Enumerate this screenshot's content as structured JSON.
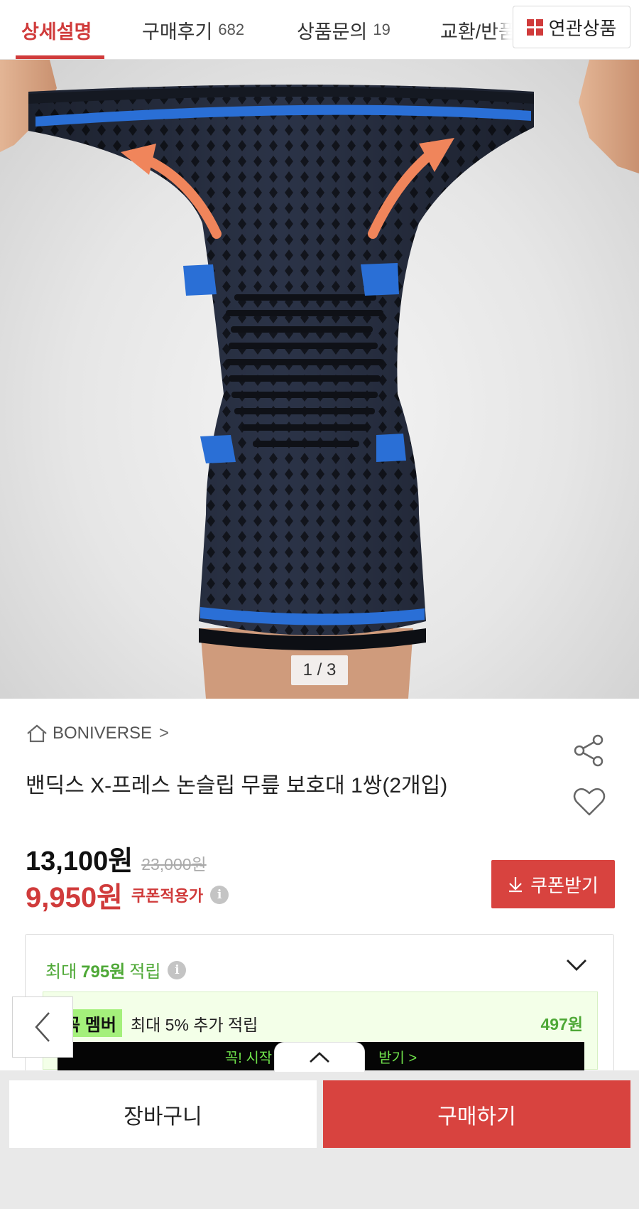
{
  "tabs": {
    "detail": "상세설명",
    "reviews": "구매후기",
    "reviews_count": "682",
    "qna": "상품문의",
    "qna_count": "19",
    "exchange": "교환/반품",
    "related": "연관상품"
  },
  "gallery": {
    "indicator": "1 / 3",
    "current": 1,
    "total": 3
  },
  "product": {
    "brand": "BONIVERSE",
    "brand_arrow": ">",
    "title": "밴딕스 X-프레스 논슬립 무릎 보호대 1쌍(2개입)",
    "price": "13,100원",
    "original_price": "23,000원",
    "coupon_price": "9,950원",
    "coupon_label": "쿠폰적용가",
    "coupon_button": "쿠폰받기"
  },
  "points": {
    "prefix": "최대",
    "amount": "795원",
    "suffix": "적립",
    "member_badge_a": "꼭",
    "member_badge_b": "멤버",
    "member_text": "최대 5% 추가 적립",
    "member_amount": "497원",
    "banner_left": "꼭! 시작",
    "banner_right": "받기 >"
  },
  "bottom_bar": {
    "cart": "장바구니",
    "buy": "구매하기"
  },
  "colors": {
    "accent": "#d8433f",
    "green": "#4ea836",
    "member_green": "#a4f07b"
  }
}
